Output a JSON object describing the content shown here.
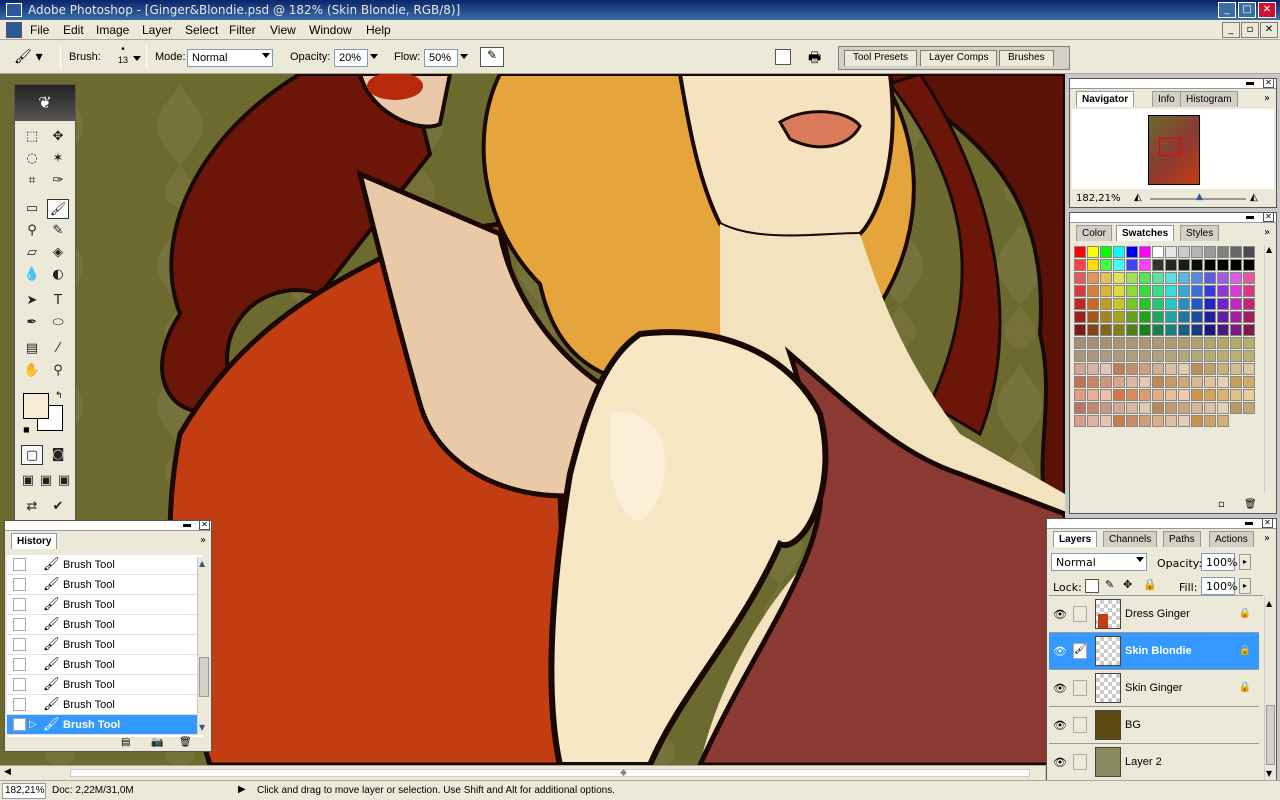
{
  "app": {
    "title": "Adobe Photoshop - [Ginger&Blondie.psd @ 182% (Skin Blondie, RGB/8)]",
    "menus": [
      "File",
      "Edit",
      "Image",
      "Layer",
      "Select",
      "Filter",
      "View",
      "Window",
      "Help"
    ]
  },
  "options": {
    "brush_label": "Brush:",
    "brush_size": "13",
    "mode_label": "Mode:",
    "mode_value": "Normal",
    "opacity_label": "Opacity:",
    "opacity_value": "20%",
    "flow_label": "Flow:",
    "flow_value": "50%",
    "palette_tabs": [
      "Tool Presets",
      "Layer Comps",
      "Brushes"
    ]
  },
  "history": {
    "tab": "History",
    "items": [
      "Brush Tool",
      "Brush Tool",
      "Brush Tool",
      "Brush Tool",
      "Brush Tool",
      "Brush Tool",
      "Brush Tool",
      "Brush Tool",
      "Brush Tool"
    ],
    "selected_index": 8
  },
  "navigator": {
    "tabs": [
      "Navigator",
      "Info",
      "Histogram"
    ],
    "active_tab": "Navigator",
    "zoom": "182,21%"
  },
  "swatches_panel": {
    "tabs": [
      "Color",
      "Swatches",
      "Styles"
    ],
    "active_tab": "Swatches"
  },
  "layers": {
    "tabs": [
      "Layers",
      "Channels",
      "Paths",
      "Actions"
    ],
    "active_tab": "Layers",
    "blend_mode": "Normal",
    "opacity_label": "Opacity:",
    "opacity_value": "100%",
    "lock_label": "Lock:",
    "fill_label": "Fill:",
    "fill_value": "100%",
    "items": [
      {
        "name": "Dress Ginger",
        "locked": true,
        "selected": false
      },
      {
        "name": "Skin Blondie",
        "locked": true,
        "selected": true
      },
      {
        "name": "Skin Ginger",
        "locked": true,
        "selected": false
      },
      {
        "name": "BG",
        "locked": false,
        "selected": false
      },
      {
        "name": "Layer 2",
        "locked": false,
        "selected": false
      }
    ]
  },
  "status": {
    "zoom": "182,21%",
    "doc": "Doc: 2,22M/31,0M",
    "hint": "Click and drag to move layer or selection.  Use Shift and Alt for additional options."
  },
  "colors": {
    "foreground": "#f7ead6",
    "background": "#ffffff",
    "selection": "#3399ff"
  }
}
